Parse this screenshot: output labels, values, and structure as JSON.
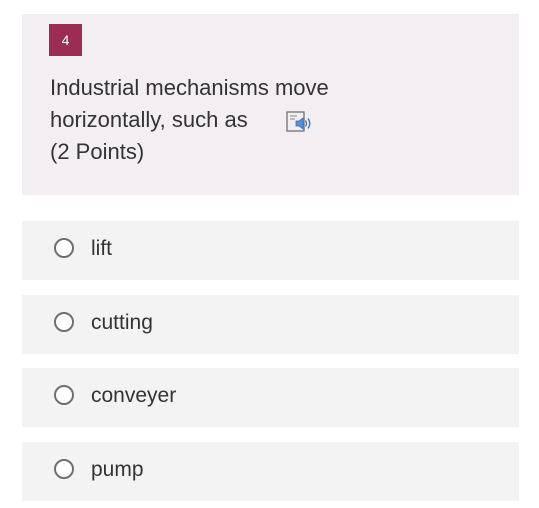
{
  "question": {
    "number": "4",
    "text": "Industrial mechanisms move horizontally, such as",
    "points": "(2 Points)",
    "read_aloud_icon": "immersive-reader-icon",
    "number_badge_color": "#9b2c54"
  },
  "options": [
    {
      "label": "lift",
      "selected": false
    },
    {
      "label": "cutting",
      "selected": false
    },
    {
      "label": "conveyer",
      "selected": false
    },
    {
      "label": "pump",
      "selected": false
    }
  ]
}
